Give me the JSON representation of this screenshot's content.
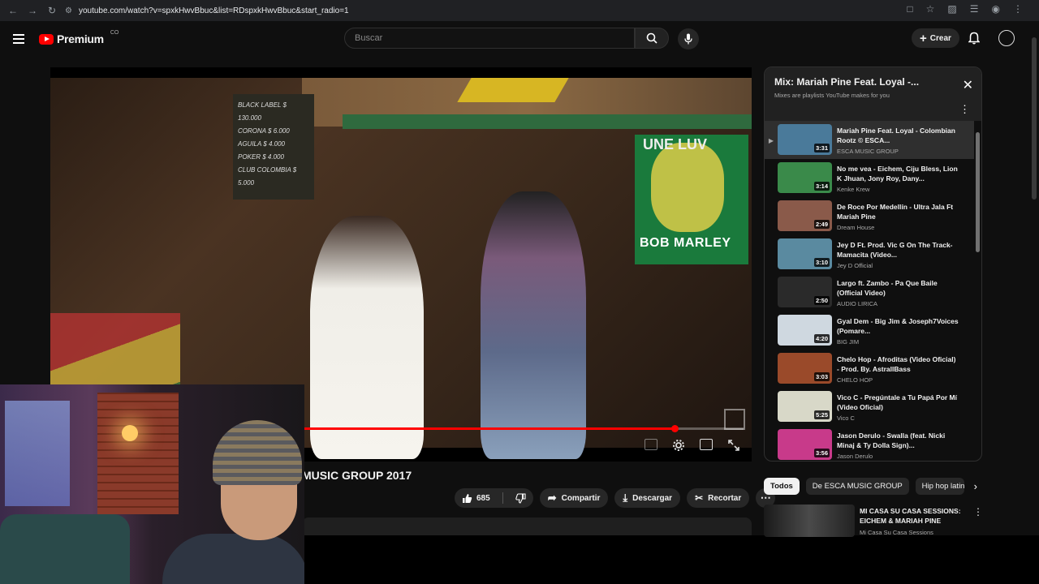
{
  "browser": {
    "url": "youtube.com/watch?v=spxkHwvBbuc&list=RDspxkHwvBbuc&start_radio=1"
  },
  "header": {
    "logo_text": "Premium",
    "country_code": "CO",
    "search_placeholder": "Buscar",
    "create_label": "Crear"
  },
  "player": {
    "progress_fraction": 0.9,
    "scene_text": {
      "sign_une": "UNE LUV",
      "sign_bob": "BOB MARLEY",
      "menu_board": [
        "BLACK LABEL $ 130.000",
        "CORONA $ 6.000",
        "AGUILA $ 4.000",
        "POKER $ 4.000",
        "CLUB COLOMBIA $ 5.000"
      ]
    }
  },
  "video": {
    "title_visible": "MUSIC GROUP 2017",
    "likes": "685",
    "share_label": "Compartir",
    "download_label": "Descargar",
    "clip_label": "Recortar"
  },
  "playlist": {
    "title": "Mix: Mariah Pine Feat. Loyal -...",
    "subtitle": "Mixes are playlists YouTube makes for you",
    "items": [
      {
        "title": "Mariah Pine Feat. Loyal - Colombian Rootz © ESCA...",
        "channel": "ESCA MUSIC GROUP",
        "duration": "3:31",
        "current": true,
        "thumb": "#4a7a9a"
      },
      {
        "title": "No me vea - Eichem, Ciju Bless, Lion K Jhuan, Jony Roy, Dany...",
        "channel": "Kenke Krew",
        "duration": "3:14",
        "current": false,
        "thumb": "#3a8a4a"
      },
      {
        "title": "De Roce Por Medellín - Ultra Jala Ft Mariah Pine",
        "channel": "Dream House",
        "duration": "2:49",
        "current": false,
        "thumb": "#8a5a4a"
      },
      {
        "title": "Jey D Ft. Prod. Vic G On The Track- Mamacita (Video...",
        "channel": "Jey D Official",
        "duration": "3:10",
        "current": false,
        "thumb": "#5a8aa0"
      },
      {
        "title": "Largo ft. Zambo - Pa Que Baile (Official Video)",
        "channel": "AUDIO LIRICA",
        "duration": "2:50",
        "current": false,
        "thumb": "#2a2a2a"
      },
      {
        "title": "Gyal Dem - Big Jim & Joseph7Voices (Pomare...",
        "channel": "BIG JIM",
        "duration": "4:20",
        "current": false,
        "thumb": "#cfd8e0"
      },
      {
        "title": "Chelo Hop - Afroditas (Video Oficial) - Prod. By. AstrallBass",
        "channel": "CHELO HOP",
        "duration": "3:03",
        "current": false,
        "thumb": "#9a4a2a"
      },
      {
        "title": "Vico C - Pregúntale a Tu Papá Por Mí (Video Oficial)",
        "channel": "Vico C",
        "duration": "5:25",
        "current": false,
        "thumb": "#d8d8c8"
      },
      {
        "title": "Jason Derulo - Swalla (feat. Nicki Minaj & Ty Dolla Sign)...",
        "channel": "Jason Derulo",
        "duration": "3:56",
        "current": false,
        "thumb": "#c83a8a"
      }
    ]
  },
  "chips": [
    "Todos",
    "De ESCA MUSIC GROUP",
    "Hip hop latino"
  ],
  "recommendation": {
    "title": "MI CASA SU CASA SESSIONS: EICHEM & MARIAH PINE",
    "channel": "Mi Casa Su Casa Sessions"
  },
  "colors": {
    "background": "#0f0f0f",
    "accent": "#ff0000",
    "surface": "#272727"
  }
}
